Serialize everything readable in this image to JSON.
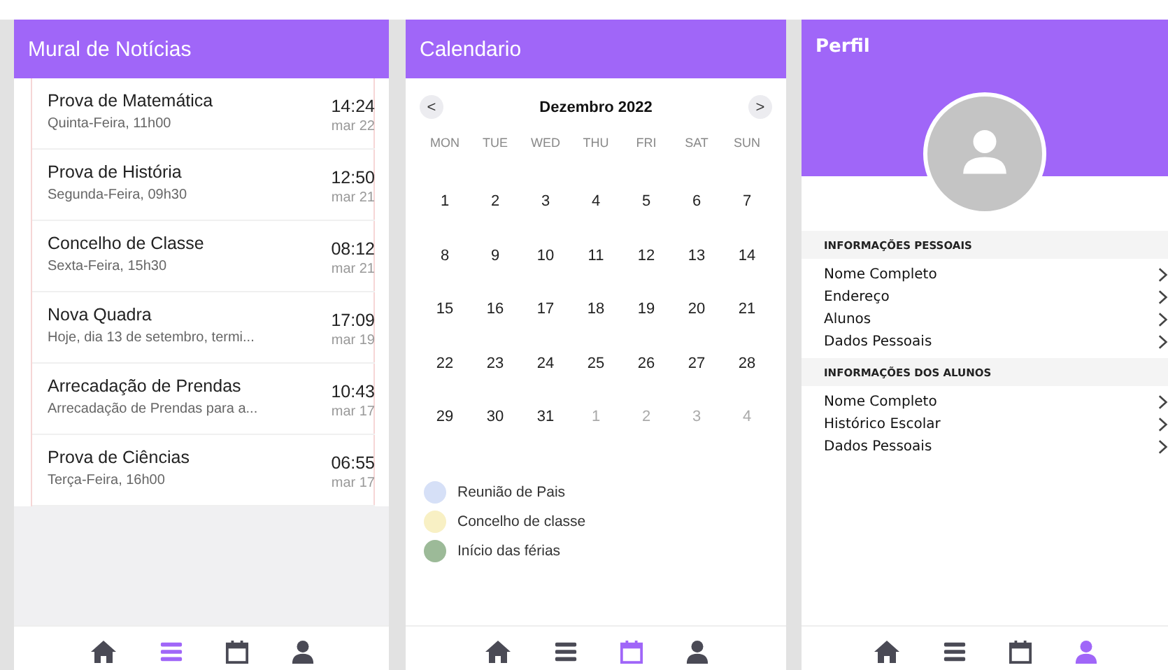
{
  "screens": [
    {
      "kind": "news",
      "title": "Mural de Notícias",
      "items": [
        {
          "title": "Prova de Matemática",
          "subtitle": "Quinta-Feira, 11h00",
          "time": "14:24",
          "date": "mar 22"
        },
        {
          "title": "Prova de História",
          "subtitle": "Segunda-Feira, 09h30",
          "time": "12:50",
          "date": "mar 21"
        },
        {
          "title": "Concelho de Classe",
          "subtitle": "Sexta-Feira, 15h30",
          "time": "08:12",
          "date": "mar 21"
        },
        {
          "title": "Nova Quadra",
          "subtitle": "Hoje, dia 13 de setembro, termi...",
          "time": "17:09",
          "date": "mar 19"
        },
        {
          "title": "Arrecadação de Prendas",
          "subtitle": "Arrecadação de Prendas para a...",
          "time": "10:43",
          "date": "mar 17"
        },
        {
          "title": "Prova de Ciências",
          "subtitle": "Terça-Feira, 16h00",
          "time": "06:55",
          "date": "mar 17"
        }
      ],
      "nav": [
        {
          "kind": "home",
          "selected": false
        },
        {
          "kind": "list",
          "selected": true
        },
        {
          "kind": "calendar",
          "selected": false
        },
        {
          "kind": "user",
          "selected": false
        }
      ]
    },
    {
      "kind": "calendar",
      "title": "Calendario",
      "month": "Dezembro 2022",
      "prev": "<",
      "next": ">",
      "weekdays": [
        "MON",
        "TUE",
        "WED",
        "THU",
        "FRI",
        "SAT",
        "SUN"
      ],
      "weeks": [
        [
          {
            "day": "1",
            "muted": false
          },
          {
            "day": "2",
            "muted": false
          },
          {
            "day": "3",
            "muted": false
          },
          {
            "day": "4",
            "muted": false
          },
          {
            "day": "5",
            "muted": false
          },
          {
            "day": "6",
            "muted": false
          },
          {
            "day": "7",
            "muted": false
          }
        ],
        [
          {
            "day": "8",
            "muted": false
          },
          {
            "day": "9",
            "muted": false
          },
          {
            "day": "10",
            "muted": false
          },
          {
            "day": "11",
            "muted": false
          },
          {
            "day": "12",
            "muted": false
          },
          {
            "day": "13",
            "muted": false
          },
          {
            "day": "14",
            "muted": false
          }
        ],
        [
          {
            "day": "15",
            "muted": false
          },
          {
            "day": "16",
            "muted": false
          },
          {
            "day": "17",
            "muted": false
          },
          {
            "day": "18",
            "muted": false
          },
          {
            "day": "19",
            "muted": false
          },
          {
            "day": "20",
            "muted": false
          },
          {
            "day": "21",
            "muted": false
          }
        ],
        [
          {
            "day": "22",
            "muted": false
          },
          {
            "day": "23",
            "muted": false
          },
          {
            "day": "24",
            "muted": false
          },
          {
            "day": "25",
            "muted": false
          },
          {
            "day": "26",
            "muted": false
          },
          {
            "day": "27",
            "muted": false
          },
          {
            "day": "28",
            "muted": false
          }
        ],
        [
          {
            "day": "29",
            "muted": false
          },
          {
            "day": "30",
            "muted": false
          },
          {
            "day": "31",
            "muted": false
          },
          {
            "day": "1",
            "muted": true
          },
          {
            "day": "2",
            "muted": true
          },
          {
            "day": "3",
            "muted": true
          },
          {
            "day": "4",
            "muted": true
          }
        ]
      ],
      "legend": [
        {
          "label": "Reunião de Pais",
          "color": "#d6e0f7"
        },
        {
          "label": "Concelho de classe",
          "color": "#f8f0c4"
        },
        {
          "label": "Início das férias",
          "color": "#9cba98"
        }
      ],
      "nav": [
        {
          "kind": "home",
          "selected": false
        },
        {
          "kind": "list",
          "selected": false
        },
        {
          "kind": "calendar",
          "selected": true
        },
        {
          "kind": "user",
          "selected": false
        }
      ]
    },
    {
      "kind": "profile",
      "title": "Perfil",
      "sections": [
        {
          "title": "INFORMAÇÕES PESSOAIS",
          "items": [
            "Nome Completo",
            "Endereço",
            "Alunos",
            "Dados Pessoais"
          ]
        },
        {
          "title": "INFORMAÇÕES DOS ALUNOS",
          "items": [
            "Nome Completo",
            "Histórico Escolar",
            "Dados Pessoais"
          ]
        }
      ],
      "nav": [
        {
          "kind": "home",
          "selected": false
        },
        {
          "kind": "list",
          "selected": false
        },
        {
          "kind": "calendar",
          "selected": false
        },
        {
          "kind": "user",
          "selected": true
        }
      ]
    }
  ]
}
